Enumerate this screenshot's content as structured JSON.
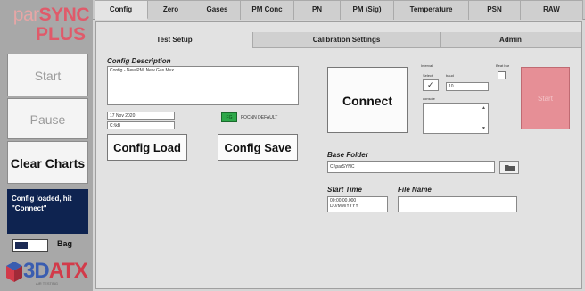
{
  "logo": {
    "line1_a": "par",
    "line1_b": "SYNC",
    "line2": "PLUS"
  },
  "left": {
    "start_label": "Start",
    "pause_label": "Pause",
    "clear_label": "Clear Charts",
    "status_text": "Config loaded, hit \"Connect\"",
    "bag_label": "Bag"
  },
  "brand": {
    "name_a": "3D",
    "name_b": "ATX",
    "sub": "AIR TESTING"
  },
  "top_tabs": [
    "Config",
    "Zero",
    "Gases",
    "PM Conc",
    "PN",
    "PM (Sig)",
    "Temperature",
    "PSN",
    "RAW"
  ],
  "sub_tabs": [
    "Test Setup",
    "Calibration Settings",
    "Admin"
  ],
  "config": {
    "desc_label": "Config Description",
    "desc_value": "Config - New PM, New Gas Mux",
    "field1_value": "17 Nov 2020",
    "field2_value": "C:\\kB",
    "led_label": "FG",
    "default_label": "FOCNN DEFAULT",
    "load_label": "Config Load",
    "save_label": "Config Save"
  },
  "connect": {
    "label": "Connect",
    "interval_label": "Interval",
    "select_label": "Select",
    "baud_label": "baud",
    "baud_value": "10",
    "console_label": "console",
    "right_label": "Beat bar",
    "start_label": "Start"
  },
  "files": {
    "base_label": "Base Folder",
    "base_value": "C:\\parSYNC",
    "start_time_label": "Start Time",
    "start_time_value": "00:00:00.000\nDD/MM/YYYY",
    "file_name_label": "File Name",
    "file_name_value": ""
  }
}
